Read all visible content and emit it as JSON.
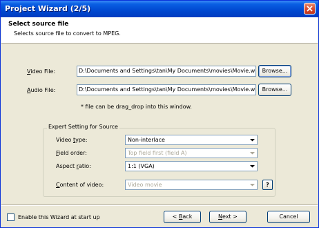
{
  "window": {
    "title": "Project Wizard (2/5)"
  },
  "header": {
    "title": "Select source file",
    "subtitle": "Selects source file to convert to MPEG."
  },
  "video": {
    "label_first": "V",
    "label_rest": "ideo File:",
    "path": "D:\\Documents and Settings\\tan\\My Documents\\movies\\Movie.wmv",
    "browse": "Browse..."
  },
  "audio": {
    "label_first": "A",
    "label_rest": "udio File:",
    "path": "D:\\Documents and Settings\\tan\\My Documents\\movies\\Movie.wmv",
    "browse": "Browse..."
  },
  "hint": "* file can be drag_drop into this window.",
  "expert": {
    "title": "Expert Setting for Source",
    "video_type": {
      "pre": "Video ",
      "u": "t",
      "post": "ype:",
      "value": "Non-interlace"
    },
    "field_order": {
      "u": "F",
      "post": "ield order:",
      "value": "Top field first (field A)"
    },
    "aspect_ratio": {
      "pre": "Aspect ",
      "u": "r",
      "post": "atio:",
      "value": "1:1 (VGA)"
    },
    "content": {
      "u": "C",
      "post": "ontent of video:",
      "value": "Video movie",
      "help": "?"
    }
  },
  "footer": {
    "checkbox_label": "Enable this Wizard at start up",
    "back": {
      "arrow": "< ",
      "u": "B",
      "post": "ack"
    },
    "next": {
      "u": "N",
      "post": "ext >"
    },
    "cancel": "Cancel"
  }
}
